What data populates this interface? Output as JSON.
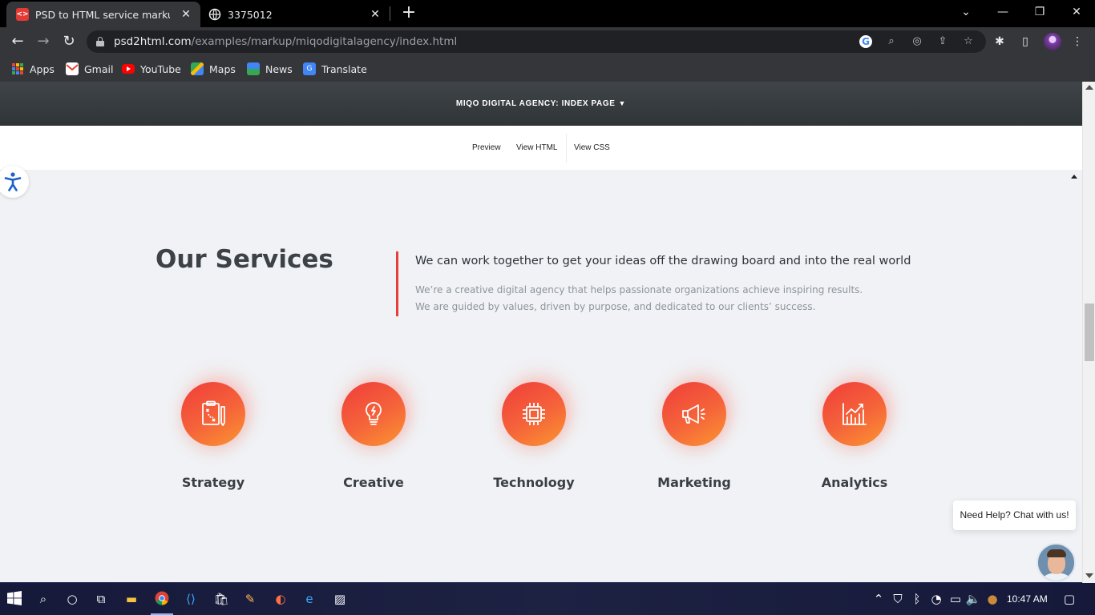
{
  "browser": {
    "tabs": [
      {
        "title": "PSD to HTML service markup exa",
        "active": true
      },
      {
        "title": "3375012",
        "active": false
      }
    ],
    "url_host": "psd2html.com",
    "url_path": "/examples/markup/miqodigitalagency/index.html",
    "bookmarks": [
      "Apps",
      "Gmail",
      "YouTube",
      "Maps",
      "News",
      "Translate"
    ]
  },
  "page": {
    "header_title": "MIQO DIGITAL AGENCY: INDEX PAGE",
    "subnav": [
      "Preview",
      "View HTML",
      "View CSS"
    ],
    "section_title": "Our Services",
    "lead": "We can work together to get your ideas off the drawing board and into the real world",
    "desc_lines": [
      "We’re a creative digital agency that helps passionate organizations achieve inspiring results.",
      "We are guided by values, driven by purpose, and dedicated to our clients’ success."
    ],
    "services": [
      {
        "label": "Strategy",
        "icon": "strategy-board-icon"
      },
      {
        "label": "Creative",
        "icon": "lightbulb-icon"
      },
      {
        "label": "Technology",
        "icon": "chip-icon"
      },
      {
        "label": "Marketing",
        "icon": "megaphone-icon"
      },
      {
        "label": "Analytics",
        "icon": "bar-chart-icon"
      }
    ],
    "chat_prompt": "Need Help? Chat with us!"
  },
  "taskbar": {
    "time": "10:47 AM"
  },
  "colors": {
    "accent_red": "#e63f37",
    "service_gradient_start": "#ef3d3a",
    "service_gradient_end": "#fb9630",
    "header_dark": "#3f4548",
    "page_background": "#f0f2f5"
  }
}
